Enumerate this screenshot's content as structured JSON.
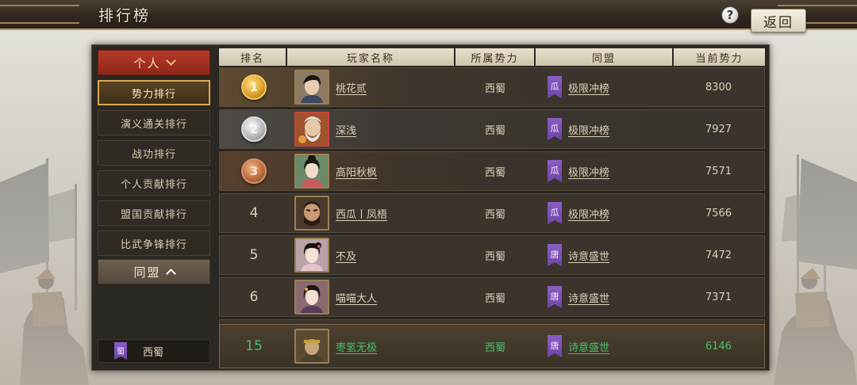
{
  "header": {
    "title": "排行榜",
    "help": "?",
    "back_label": "返回"
  },
  "sidebar": {
    "personal_header": "个人",
    "items": [
      {
        "label": "势力排行",
        "active": true
      },
      {
        "label": "演义通关排行",
        "active": false
      },
      {
        "label": "战功排行",
        "active": false
      },
      {
        "label": "个人贡献排行",
        "active": false
      },
      {
        "label": "盟国贡献排行",
        "active": false
      },
      {
        "label": "比武争锋排行",
        "active": false
      }
    ],
    "alliance_header": "同盟",
    "my_faction": {
      "emblem": "蜀",
      "name": "西蜀"
    }
  },
  "table": {
    "columns": [
      "排名",
      "玩家名称",
      "所属势力",
      "同盟",
      "当前势力"
    ],
    "rows": [
      {
        "rank": "1",
        "medal": "gold",
        "name": "桃花贰",
        "faction": "西蜀",
        "alliance_emblem": "瓜",
        "alliance": "极限冲榜",
        "power": "8300"
      },
      {
        "rank": "2",
        "medal": "silver",
        "name": "深浅",
        "faction": "西蜀",
        "alliance_emblem": "瓜",
        "alliance": "极限冲榜",
        "power": "7927"
      },
      {
        "rank": "3",
        "medal": "bronze",
        "name": "高阳秋枫",
        "faction": "西蜀",
        "alliance_emblem": "瓜",
        "alliance": "极限冲榜",
        "power": "7571"
      },
      {
        "rank": "4",
        "name": "西瓜丨凤梧",
        "faction": "西蜀",
        "alliance_emblem": "瓜",
        "alliance": "极限冲榜",
        "power": "7566"
      },
      {
        "rank": "5",
        "name": "不及",
        "faction": "西蜀",
        "alliance_emblem": "唐",
        "alliance": "诗意盛世",
        "power": "7472"
      },
      {
        "rank": "6",
        "name": "喵喵大人",
        "faction": "西蜀",
        "alliance_emblem": "唐",
        "alliance": "诗意盛世",
        "power": "7371"
      }
    ],
    "self_row": {
      "rank": "15",
      "name": "枣氢无极",
      "faction": "西蜀",
      "alliance_emblem": "唐",
      "alliance": "诗意盛世",
      "power": "6146"
    }
  }
}
